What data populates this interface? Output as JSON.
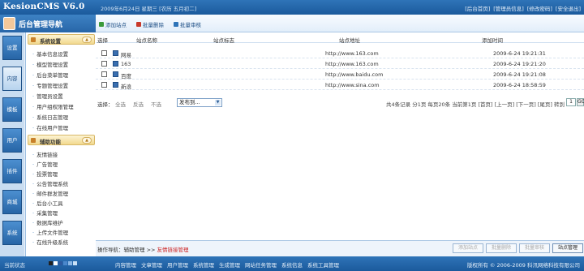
{
  "header": {
    "logo": "KesionCMS V6.0",
    "datetime": "2009年6月24日 星期三 [农历 五月初二]",
    "links": [
      "[后台首页]",
      "[管理员信息]",
      "[修改密码]",
      "[安全退出]"
    ]
  },
  "sidebar": {
    "title": "后台管理导航",
    "tabs": [
      "设置",
      "内容",
      "模板",
      "用户",
      "插件",
      "商城",
      "系统"
    ],
    "active_tab": 1,
    "groups": [
      {
        "label": "系统设置",
        "items": [
          "基本信息设置",
          "模型管理设置",
          "后台菜单管理",
          "专题管理设置",
          "管理员设置",
          "用户组权限管理",
          "系统日志管理",
          "在线用户管理"
        ]
      },
      {
        "label": "辅助功能",
        "items": [
          "友情链接",
          "广告管理",
          "投票管理",
          "公告管理系统",
          "邮件群发管理",
          "后台小工具",
          "采集管理",
          "数据库维护",
          "上传文件管理",
          "在线升级系统"
        ]
      }
    ]
  },
  "toolbar": {
    "buttons": [
      {
        "label": "添加站点",
        "color": "#3b9a3b"
      },
      {
        "label": "批量删除",
        "color": "#c8392b"
      },
      {
        "label": "批量审核",
        "color": "#2f74b8"
      }
    ]
  },
  "table": {
    "headers": [
      "选择",
      "站点名称",
      "站点标志",
      "站点地址",
      "添加时间"
    ],
    "rows": [
      {
        "name": "网易",
        "logo": "",
        "url": "http://www.163.com",
        "date": "2009-6-24 19:21:31"
      },
      {
        "name": "163",
        "logo": "",
        "url": "http://www.163.com",
        "date": "2009-6-24 19:21:20"
      },
      {
        "name": "百度",
        "logo": "",
        "url": "http://www.baidu.com",
        "date": "2009-6-24 19:21:08"
      },
      {
        "name": "新浪",
        "logo": "",
        "url": "http://www.sina.com",
        "date": "2009-6-24 18:58:59"
      }
    ]
  },
  "selection": {
    "label": "选择：",
    "links": [
      "全选",
      "反选",
      "不选"
    ],
    "dropdown_value": "发布到..."
  },
  "pager": {
    "text": "共4条记录 分1页 每页20条 当前第1页 [首页] [上一页] [下一页] [尾页] 转到",
    "page_value": "1",
    "go_label": "GO"
  },
  "statusbar": {
    "prefix": "操作导航：辅助管理 >> ",
    "current": "友情链接管理",
    "buttons": [
      {
        "label": "添加站点",
        "enabled": false
      },
      {
        "label": "批量删除",
        "enabled": false
      },
      {
        "label": "批量审核",
        "enabled": false
      },
      {
        "label": "站点管理",
        "enabled": true
      }
    ]
  },
  "footer": {
    "status": "当前状态",
    "swatches": [
      "#222222",
      "#ffffff",
      "#2d5aa0",
      "#4b88cc",
      "#8ab6e6",
      "#c9e0f6"
    ],
    "links": [
      "内容管理",
      "文章管理",
      "用户管理",
      "系统管理",
      "生成管理",
      "网站任务管理",
      "系统信息",
      "系统工具管理"
    ],
    "copyright": "版权所有 © 2006-2009 科汛网络科技有限公司"
  }
}
